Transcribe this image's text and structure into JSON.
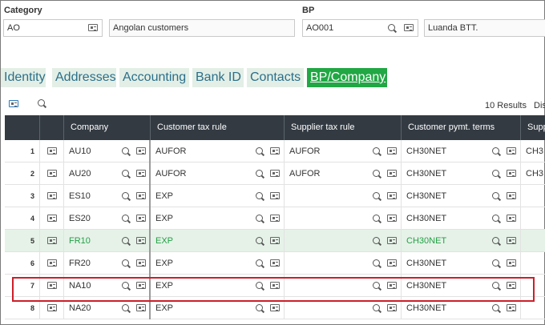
{
  "header": {
    "category_label": "Category",
    "category_value": "AO",
    "category_description": "Angolan customers",
    "bp_label": "BP",
    "bp_value": "AO001",
    "bp_description": "Luanda BTT."
  },
  "tabs": [
    {
      "label": "Identity",
      "active": false
    },
    {
      "label": "Addresses",
      "active": false
    },
    {
      "label": "Accounting",
      "active": false
    },
    {
      "label": "Bank ID",
      "active": false
    },
    {
      "label": "Contacts",
      "active": false
    },
    {
      "label": "BP/Company",
      "active": true
    }
  ],
  "toolbar": {
    "results_text": "10 Results",
    "display_text": "Disp"
  },
  "grid": {
    "columns": [
      "Company",
      "Customer tax rule",
      "Supplier tax rule",
      "Customer pymt. terms",
      "Supp"
    ],
    "rows": [
      {
        "num": "1",
        "company": "AU10",
        "cust_tax": "AUFOR",
        "supp_tax": "AUFOR",
        "cust_terms": "CH30NET",
        "supp_terms": "CH3"
      },
      {
        "num": "2",
        "company": "AU20",
        "cust_tax": "AUFOR",
        "supp_tax": "AUFOR",
        "cust_terms": "CH30NET",
        "supp_terms": "CH3"
      },
      {
        "num": "3",
        "company": "ES10",
        "cust_tax": "EXP",
        "supp_tax": "",
        "cust_terms": "CH30NET",
        "supp_terms": ""
      },
      {
        "num": "4",
        "company": "ES20",
        "cust_tax": "EXP",
        "supp_tax": "",
        "cust_terms": "CH30NET",
        "supp_terms": ""
      },
      {
        "num": "5",
        "company": "FR10",
        "cust_tax": "EXP",
        "supp_tax": "",
        "cust_terms": "CH30NET",
        "supp_terms": ""
      },
      {
        "num": "6",
        "company": "FR20",
        "cust_tax": "EXP",
        "supp_tax": "",
        "cust_terms": "CH30NET",
        "supp_terms": ""
      },
      {
        "num": "7",
        "company": "NA10",
        "cust_tax": "EXP",
        "supp_tax": "",
        "cust_terms": "CH30NET",
        "supp_terms": ""
      },
      {
        "num": "8",
        "company": "NA20",
        "cust_tax": "EXP",
        "supp_tax": "",
        "cust_terms": "CH30NET",
        "supp_terms": ""
      }
    ],
    "selected_row": "5",
    "highlighted_row": "7"
  },
  "colors": {
    "accent_green": "#21a744",
    "tab_bg": "#e3efe6",
    "tab_text": "#2b6f8a",
    "header_bg": "#333a42",
    "highlight_red": "#cc1f2a"
  }
}
